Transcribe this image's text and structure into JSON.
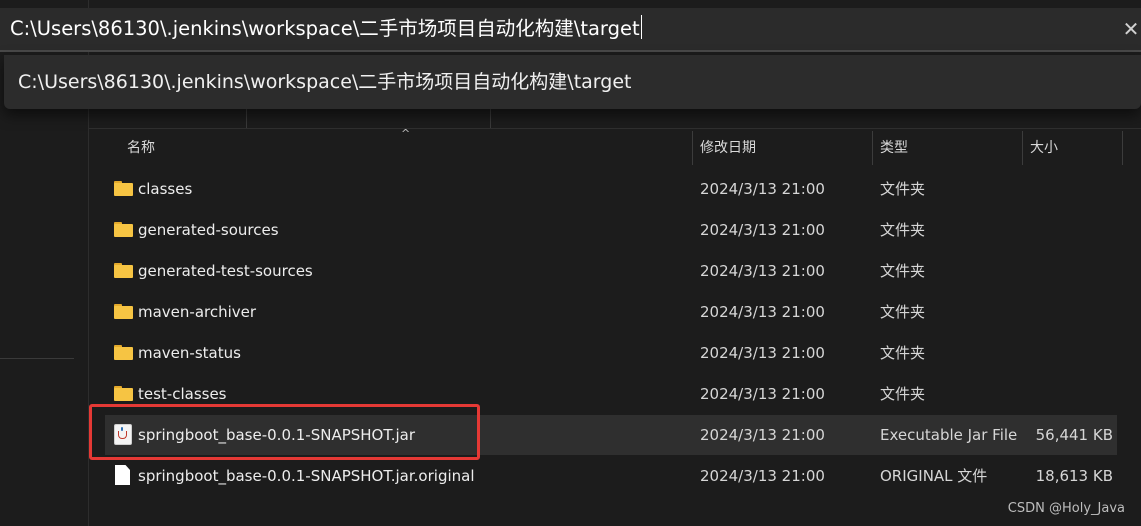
{
  "address_bar": {
    "value": "C:\\Users\\86130\\.jenkins\\workspace\\二手市场项目自动化构建\\target",
    "clear_glyph": "✕"
  },
  "suggestions": [
    "C:\\Users\\86130\\.jenkins\\workspace\\二手市场项目自动化构建\\target"
  ],
  "columns": {
    "name": "名称",
    "date_modified": "修改日期",
    "type": "类型",
    "size": "大小"
  },
  "rows": [
    {
      "icon": "folder-icon",
      "name": "classes",
      "date": "2024/3/13 21:00",
      "type": "文件夹",
      "size": ""
    },
    {
      "icon": "folder-icon",
      "name": "generated-sources",
      "date": "2024/3/13 21:00",
      "type": "文件夹",
      "size": ""
    },
    {
      "icon": "folder-icon",
      "name": "generated-test-sources",
      "date": "2024/3/13 21:00",
      "type": "文件夹",
      "size": ""
    },
    {
      "icon": "folder-icon",
      "name": "maven-archiver",
      "date": "2024/3/13 21:00",
      "type": "文件夹",
      "size": ""
    },
    {
      "icon": "folder-icon",
      "name": "maven-status",
      "date": "2024/3/13 21:00",
      "type": "文件夹",
      "size": ""
    },
    {
      "icon": "folder-icon",
      "name": "test-classes",
      "date": "2024/3/13 21:00",
      "type": "文件夹",
      "size": ""
    },
    {
      "icon": "java-jar-icon",
      "name": "springboot_base-0.0.1-SNAPSHOT.jar",
      "date": "2024/3/13 21:00",
      "type": "Executable Jar File",
      "size": "56,441 KB"
    },
    {
      "icon": "file-icon",
      "name": "springboot_base-0.0.1-SNAPSHOT.jar.original",
      "date": "2024/3/13 21:00",
      "type": "ORIGINAL 文件",
      "size": "18,613 KB"
    }
  ],
  "watermark": "CSDN @Holy_Java",
  "colors": {
    "background": "#1c1c1c",
    "folder": "#f6c443",
    "highlight": "#e53935",
    "selected_row": "#2f2f2f"
  }
}
